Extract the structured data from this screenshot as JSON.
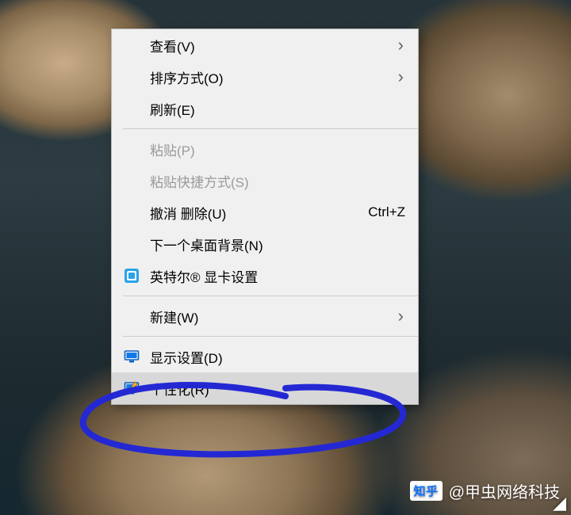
{
  "menu": {
    "groups": [
      [
        {
          "id": "view",
          "label": "查看(V)",
          "submenu": true
        },
        {
          "id": "sort",
          "label": "排序方式(O)",
          "submenu": true
        },
        {
          "id": "refresh",
          "label": "刷新(E)"
        }
      ],
      [
        {
          "id": "paste",
          "label": "粘贴(P)",
          "disabled": true
        },
        {
          "id": "paste-shortcut",
          "label": "粘贴快捷方式(S)",
          "disabled": true
        },
        {
          "id": "undo-delete",
          "label": "撤消 删除(U)",
          "shortcut": "Ctrl+Z"
        },
        {
          "id": "next-wallpaper",
          "label": "下一个桌面背景(N)"
        },
        {
          "id": "intel-graphics",
          "label": "英特尔® 显卡设置",
          "icon": "intel"
        }
      ],
      [
        {
          "id": "new",
          "label": "新建(W)",
          "submenu": true
        }
      ],
      [
        {
          "id": "display-settings",
          "label": "显示设置(D)",
          "icon": "display"
        },
        {
          "id": "personalize",
          "label": "个性化(R)",
          "icon": "personalize",
          "selected": true
        }
      ]
    ]
  },
  "annotation_color": "#2428d3",
  "watermark": {
    "site": "知乎",
    "author": "@甲虫网络科技"
  }
}
